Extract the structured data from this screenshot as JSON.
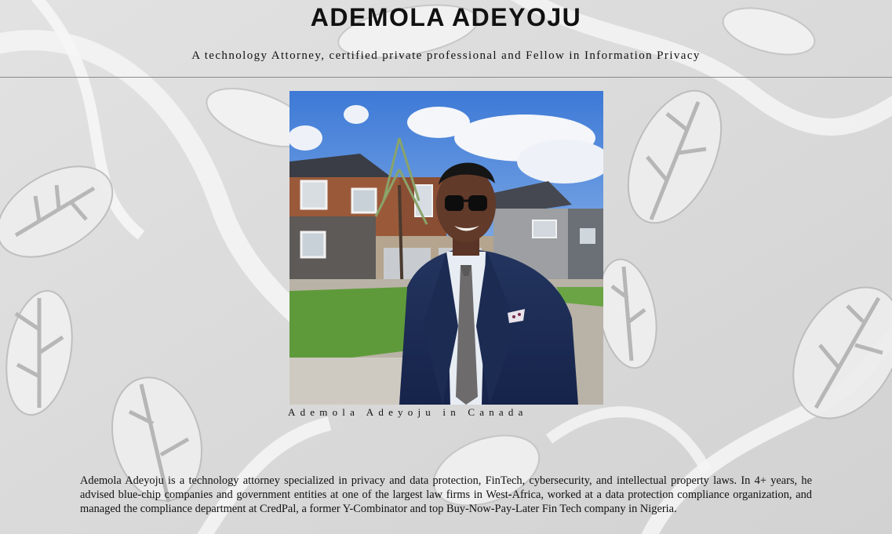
{
  "header": {
    "title": "ADEMOLA ADEYOJU",
    "subtitle": "A technology Attorney, certified private professional and Fellow in Information Privacy"
  },
  "profile": {
    "photo_icon": "portrait-photo",
    "caption": "Ademola Adeyoju in Canada"
  },
  "bio": {
    "text": "Ademola Adeyoju is a technology attorney specialized in privacy and data protection, FinTech, cybersecurity, and intellectual property laws. In 4+ years, he advised blue-chip companies and government entities at one of the largest law firms in West-Africa, worked at a data protection compliance organization, and managed the compliance department at CredPal, a former Y-Combinator and top Buy-Now-Pay-Later Fin Tech company in Nigeria."
  },
  "colors": {
    "background": "#dcdcdc",
    "text": "#111111",
    "rule": "#8a8a8a"
  }
}
